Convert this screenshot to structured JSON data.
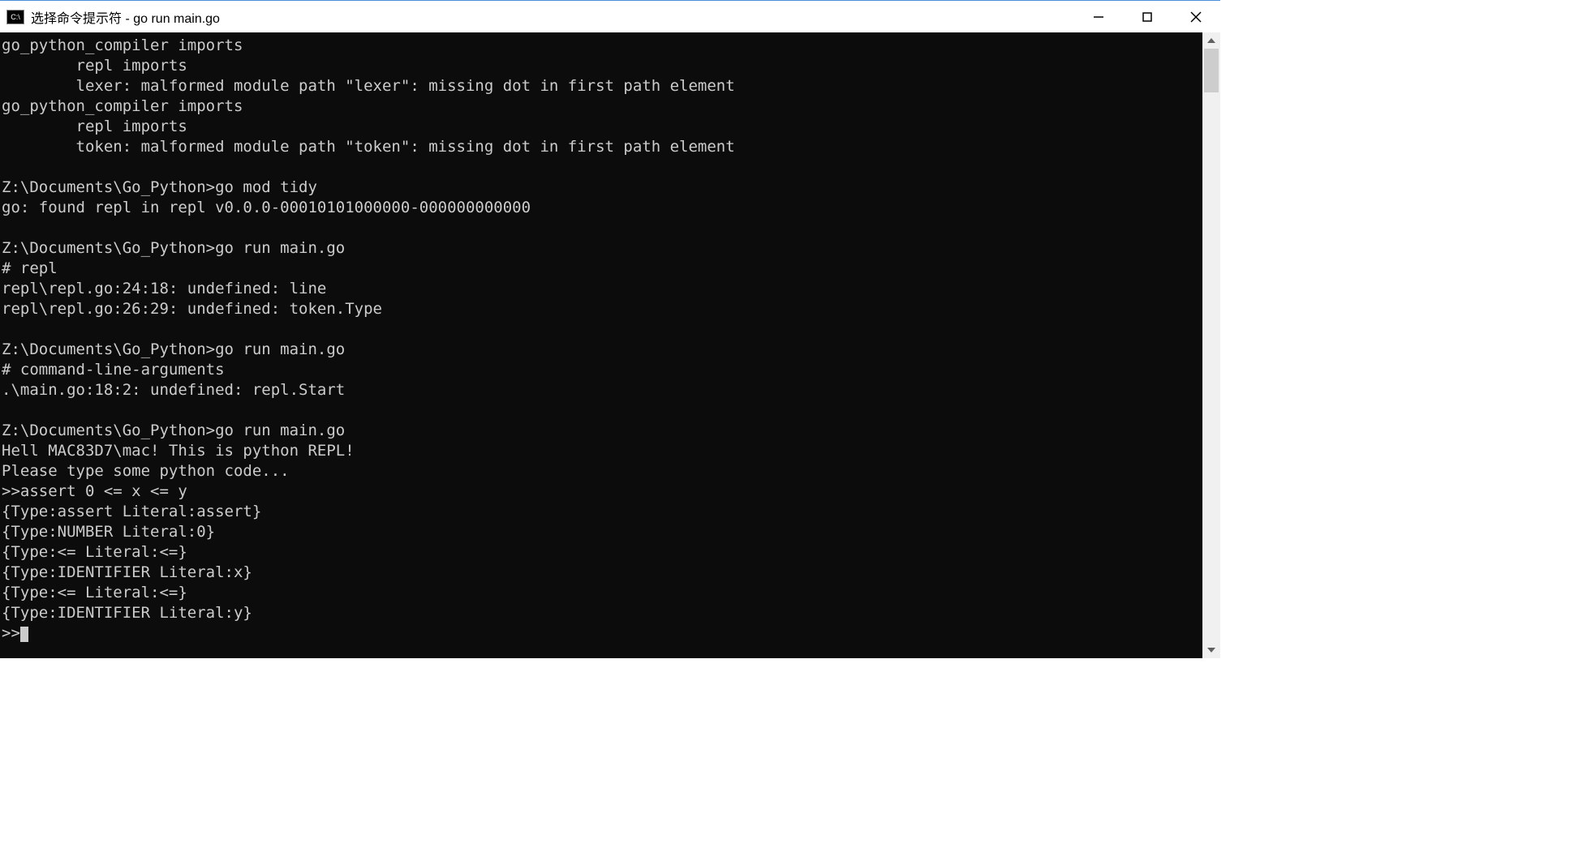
{
  "window": {
    "icon_text": "C:\\",
    "title": "选择命令提示符 - go  run main.go"
  },
  "terminal": {
    "lines": [
      "go_python_compiler imports",
      "        repl imports",
      "        lexer: malformed module path \"lexer\": missing dot in first path element",
      "go_python_compiler imports",
      "        repl imports",
      "        token: malformed module path \"token\": missing dot in first path element",
      "",
      "Z:\\Documents\\Go_Python>go mod tidy",
      "go: found repl in repl v0.0.0-00010101000000-000000000000",
      "",
      "Z:\\Documents\\Go_Python>go run main.go",
      "# repl",
      "repl\\repl.go:24:18: undefined: line",
      "repl\\repl.go:26:29: undefined: token.Type",
      "",
      "Z:\\Documents\\Go_Python>go run main.go",
      "# command-line-arguments",
      ".\\main.go:18:2: undefined: repl.Start",
      "",
      "Z:\\Documents\\Go_Python>go run main.go",
      "Hell MAC83D7\\mac! This is python REPL!",
      "Please type some python code...",
      ">>assert 0 <= x <= y",
      "{Type:assert Literal:assert}",
      "{Type:NUMBER Literal:0}",
      "{Type:<= Literal:<=}",
      "{Type:IDENTIFIER Literal:x}",
      "{Type:<= Literal:<=}",
      "{Type:IDENTIFIER Literal:y}",
      ">>"
    ]
  }
}
